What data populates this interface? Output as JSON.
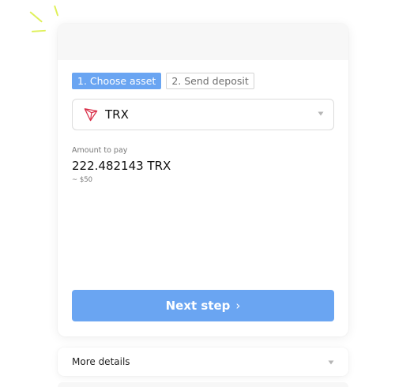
{
  "steps": [
    {
      "label": "1. Choose asset",
      "active": true
    },
    {
      "label": "2. Send deposit",
      "active": false
    }
  ],
  "asset_select": {
    "selected": "TRX",
    "icon": "tron-logo-icon"
  },
  "amount": {
    "label": "Amount to pay",
    "value": "222.482143 TRX",
    "usd": "~ $50"
  },
  "next_button": {
    "label": "Next step",
    "chevron": "›"
  },
  "details": {
    "label": "More details"
  },
  "colors": {
    "accent": "#6aa5f2",
    "tron_red": "#d9304a",
    "sparkle": "#dff059"
  }
}
